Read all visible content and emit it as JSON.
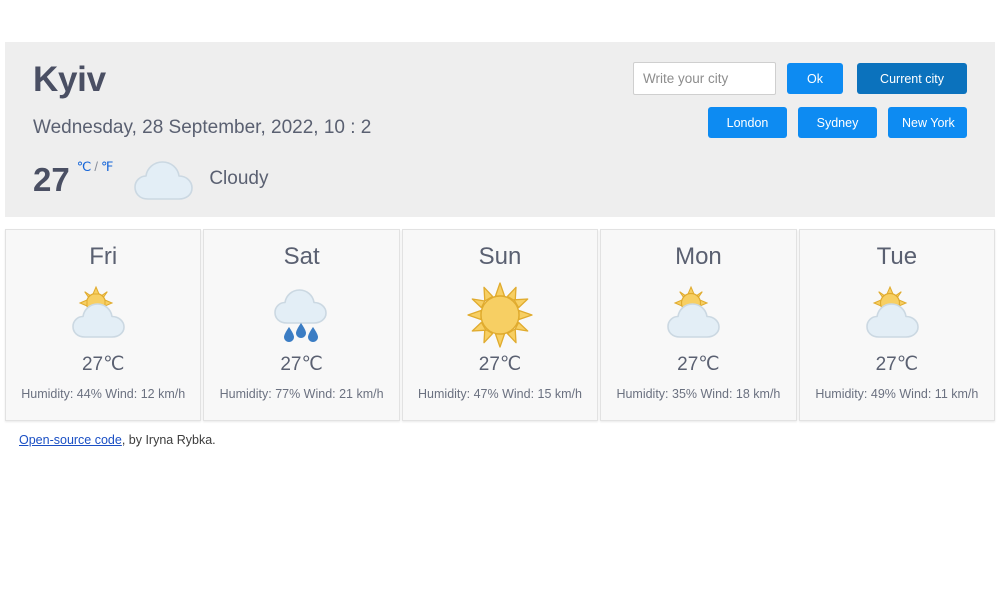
{
  "header": {
    "city": "Kyiv",
    "date": "Wednesday, 28 September, 2022, 10 : 2",
    "current_temp": "27",
    "unit_celsius": "℃",
    "unit_separator": "/",
    "unit_fahrenheit": "℉",
    "condition": "Cloudy",
    "condition_icon": "cloud-icon"
  },
  "search": {
    "placeholder": "Write your city",
    "value": "",
    "ok_label": "Ok",
    "current_city_label": "Current city"
  },
  "quick_cities": [
    {
      "label": "London"
    },
    {
      "label": "Sydney"
    },
    {
      "label": "New York"
    }
  ],
  "forecast": [
    {
      "day": "Fri",
      "icon": "sun-behind-cloud-icon",
      "temp": "27℃",
      "meta": "Humidity: 44% Wind: 12 km/h",
      "humidity": 44,
      "wind": 12
    },
    {
      "day": "Sat",
      "icon": "rain-cloud-icon",
      "temp": "27℃",
      "meta": "Humidity: 77% Wind: 21 km/h",
      "humidity": 77,
      "wind": 21
    },
    {
      "day": "Sun",
      "icon": "sun-icon",
      "temp": "27℃",
      "meta": "Humidity: 47% Wind: 15 km/h",
      "humidity": 47,
      "wind": 15
    },
    {
      "day": "Mon",
      "icon": "sun-behind-cloud-icon",
      "temp": "27℃",
      "meta": "Humidity: 35% Wind: 18 km/h",
      "humidity": 35,
      "wind": 18
    },
    {
      "day": "Tue",
      "icon": "sun-behind-cloud-icon",
      "temp": "27℃",
      "meta": "Humidity: 49% Wind: 11 km/h",
      "humidity": 49,
      "wind": 11
    }
  ],
  "footer": {
    "link_text": "Open-source code",
    "credit_text": ", by Iryna Rybka."
  },
  "colors": {
    "panel_bg": "#eeeeee",
    "card_bg": "#f8f8f8",
    "accent_light": "#0d8bf2",
    "accent_dark": "#0b72bd",
    "text": "#5a6071",
    "link": "#1565d8",
    "sun": "#f5c council",
    "cloud": "#dce9f2",
    "raindrop": "#3b7dc4"
  }
}
